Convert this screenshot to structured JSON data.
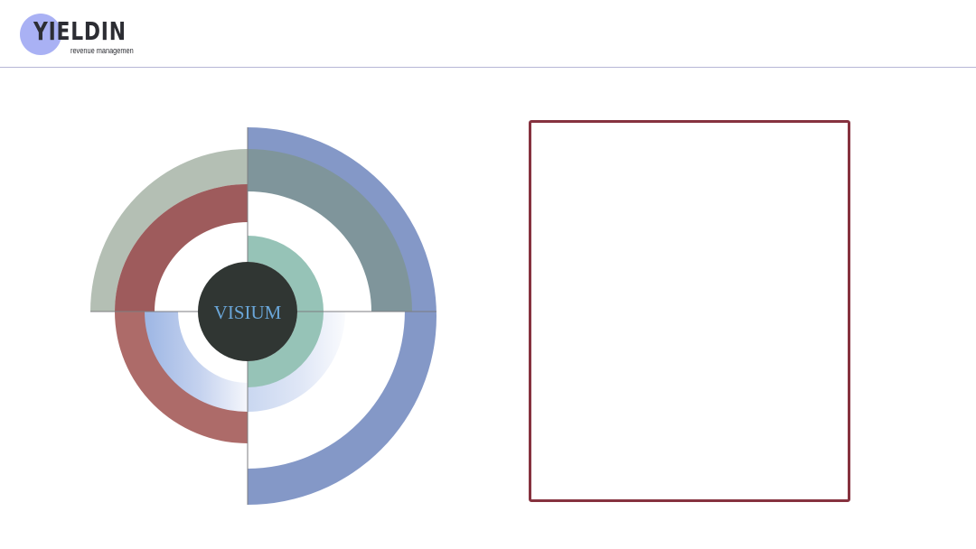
{
  "logo": {
    "wordmark": "YIELDIN",
    "tagline": "revenue managemen"
  },
  "diagram": {
    "center_label": "VISIUM",
    "colors": {
      "outer_blue": "#8498c7",
      "gray_green": "#b4bfb4",
      "slate_overlap": "#7f959b",
      "red_left": "#9e5b5c",
      "red_lower": "#ad6b69",
      "teal": "#96c3b7",
      "light_blue": "#a5bde6",
      "center_dark": "#303633",
      "center_text": "#6aa6d8",
      "box_border": "#86323f"
    }
  },
  "text_box": {
    "content": ""
  }
}
